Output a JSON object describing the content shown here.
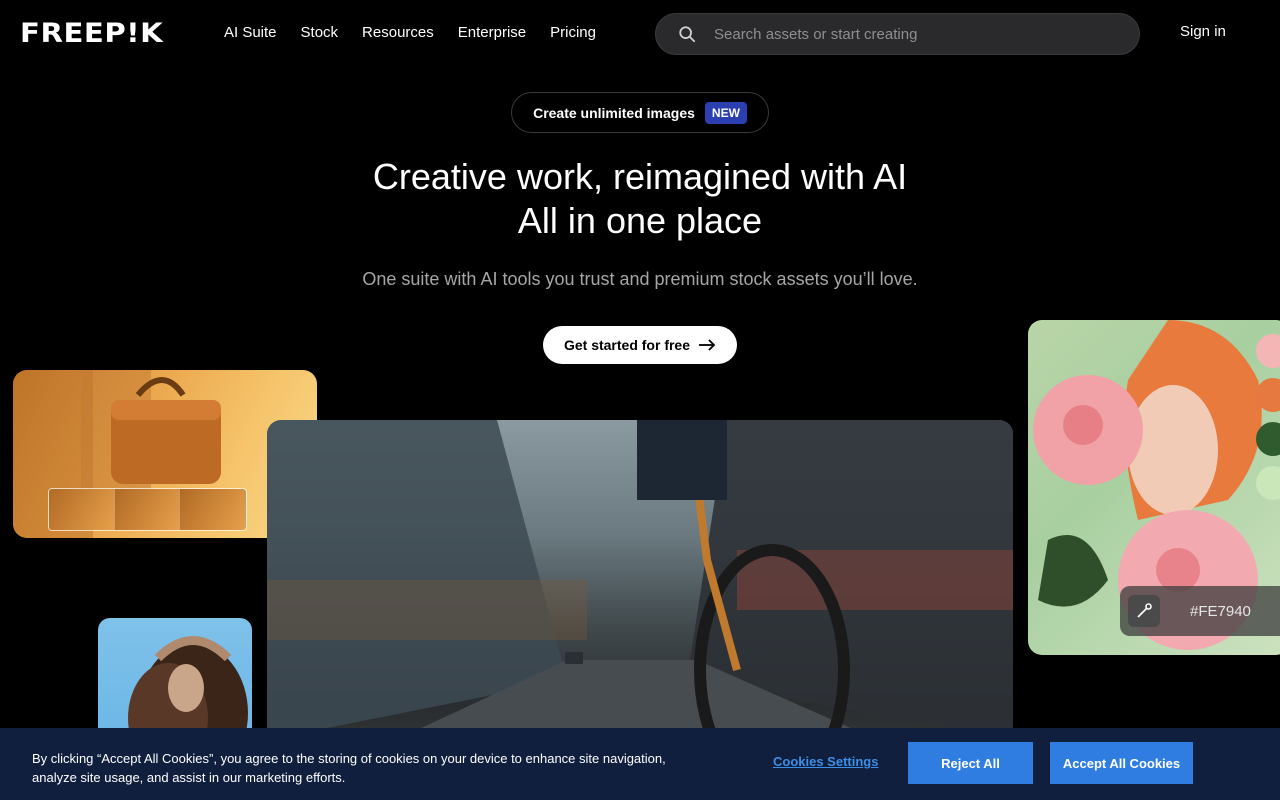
{
  "header": {
    "logo": "FREEP!K",
    "nav": [
      "AI Suite",
      "Stock",
      "Resources",
      "Enterprise",
      "Pricing"
    ],
    "search_placeholder": "Search assets or start creating",
    "signin": "Sign in"
  },
  "hero": {
    "pill_text": "Create unlimited images",
    "pill_badge": "NEW",
    "title_line1": "Creative work, reimagined with AI",
    "title_line2": "All in one place",
    "subtitle": "One suite with AI tools you trust and premium stock assets you’ll love.",
    "cta": "Get started for free"
  },
  "gallery": {
    "color_hex": "#FE7940",
    "swatch_colors": [
      "#f4b5b5",
      "#e5793f",
      "#2f5b2f",
      "#c9e7b8"
    ]
  },
  "cookie": {
    "message": "By clicking “Accept All Cookies”, you agree to the storing of cookies on your device to enhance site navigation, analyze site usage, and assist in our marketing efforts.",
    "settings": "Cookies Settings",
    "reject": "Reject All",
    "accept": "Accept All Cookies"
  }
}
